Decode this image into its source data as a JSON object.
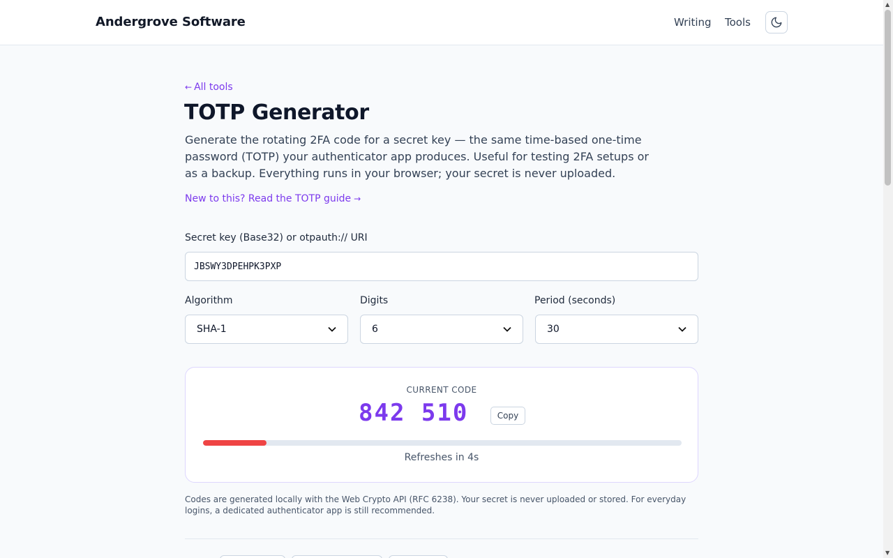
{
  "header": {
    "brand": "Andergrove Software",
    "nav": [
      {
        "label": "Writing"
      },
      {
        "label": "Tools"
      }
    ],
    "theme_toggle_icon": "moon-icon"
  },
  "page": {
    "back_link": "All tools",
    "back_arrow": "←",
    "title": "TOTP Generator",
    "intro": "Generate the rotating 2FA code for a secret key — the same time-based one-time password (TOTP) your authenticator app produces. Useful for testing 2FA setups or as a backup. Everything runs in your browser; your secret is never uploaded.",
    "guide_link": "New to this? Read the TOTP guide",
    "guide_arrow": "→"
  },
  "form": {
    "secret_label": "Secret key (Base32) or otpauth:// URI",
    "secret_value": "JBSWY3DPEHPK3PXP",
    "algorithm_label": "Algorithm",
    "algorithm_value": "SHA-1",
    "digits_label": "Digits",
    "digits_value": "6",
    "period_label": "Period (seconds)",
    "period_value": "30"
  },
  "code": {
    "label": "CURRENT CODE",
    "value": "842 510",
    "copy_label": "Copy",
    "refresh_text": "Refreshes in 4s",
    "remaining_fraction": 0.133,
    "bar_color": "#ef4444",
    "accent_color": "#7c3aed"
  },
  "footnote": "Codes are generated locally with the Web Crypto API (RFC 6238). Your secret is never uploaded or stored. For everyday logins, a dedicated authenticator app is still recommended."
}
